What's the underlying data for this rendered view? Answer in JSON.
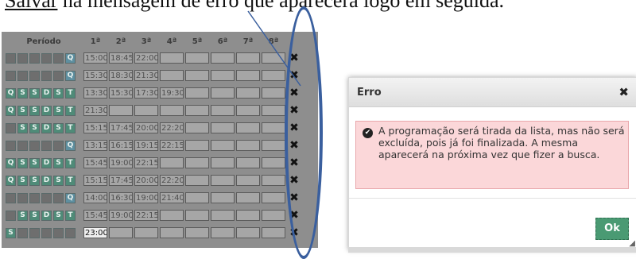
{
  "caption": {
    "underlined": "Salvar",
    "rest": " na mensagem de erro que aparecerá logo em seguida."
  },
  "table": {
    "headers": [
      "Período",
      "1ª",
      "2ª",
      "3ª",
      "4ª",
      "5ª",
      "6ª",
      "7ª",
      "8ª"
    ],
    "rows": [
      {
        "days": [
          "",
          "",
          "",
          "",
          "",
          "Q"
        ],
        "day_states": [
          "off",
          "off",
          "off",
          "off",
          "off",
          "sel"
        ],
        "slots": [
          "15:00",
          "18:45",
          "22:00",
          "",
          "",
          "",
          "",
          ""
        ]
      },
      {
        "days": [
          "",
          "",
          "",
          "",
          "",
          "Q"
        ],
        "day_states": [
          "off",
          "off",
          "off",
          "off",
          "off",
          "sel"
        ],
        "slots": [
          "15:30",
          "18:30",
          "21:30",
          "",
          "",
          "",
          "",
          ""
        ]
      },
      {
        "days": [
          "Q",
          "S",
          "S",
          "D",
          "S",
          "T"
        ],
        "day_states": [
          "on",
          "on",
          "on",
          "on",
          "on",
          "on"
        ],
        "slots": [
          "13:30",
          "15:30",
          "17:30",
          "19:30",
          "",
          "",
          "",
          ""
        ]
      },
      {
        "days": [
          "Q",
          "S",
          "S",
          "D",
          "S",
          "T"
        ],
        "day_states": [
          "on",
          "on",
          "on",
          "on",
          "on",
          "on"
        ],
        "slots": [
          "21:30",
          "",
          "",
          "",
          "",
          "",
          "",
          ""
        ]
      },
      {
        "days": [
          "",
          "S",
          "S",
          "D",
          "S",
          "T"
        ],
        "day_states": [
          "off",
          "on",
          "on",
          "on",
          "on",
          "on"
        ],
        "slots": [
          "15:15",
          "17:45",
          "20:00",
          "22:20",
          "",
          "",
          "",
          ""
        ]
      },
      {
        "days": [
          "",
          "",
          "",
          "",
          "",
          "Q"
        ],
        "day_states": [
          "off",
          "off",
          "off",
          "off",
          "off",
          "sel"
        ],
        "slots": [
          "13:15",
          "16:15",
          "19:15",
          "22:15",
          "",
          "",
          "",
          ""
        ]
      },
      {
        "days": [
          "Q",
          "S",
          "S",
          "D",
          "S",
          "T"
        ],
        "day_states": [
          "on",
          "on",
          "on",
          "on",
          "on",
          "on"
        ],
        "slots": [
          "15:45",
          "19:00",
          "22:15",
          "",
          "",
          "",
          "",
          ""
        ]
      },
      {
        "days": [
          "Q",
          "S",
          "S",
          "D",
          "S",
          "T"
        ],
        "day_states": [
          "on",
          "on",
          "on",
          "on",
          "on",
          "on"
        ],
        "slots": [
          "15:15",
          "17:45",
          "20:00",
          "22:20",
          "",
          "",
          "",
          ""
        ]
      },
      {
        "days": [
          "",
          "",
          "",
          "",
          "",
          "Q"
        ],
        "day_states": [
          "off",
          "off",
          "off",
          "off",
          "off",
          "sel"
        ],
        "slots": [
          "14:00",
          "16:30",
          "19:00",
          "21:40",
          "",
          "",
          "",
          ""
        ]
      },
      {
        "days": [
          "",
          "S",
          "S",
          "D",
          "S",
          "T"
        ],
        "day_states": [
          "off",
          "on",
          "on",
          "on",
          "on",
          "on"
        ],
        "slots": [
          "15:45",
          "19:00",
          "22:15",
          "",
          "",
          "",
          "",
          ""
        ]
      },
      {
        "days": [
          "S",
          "",
          "",
          "",
          "",
          ""
        ],
        "day_states": [
          "on",
          "off",
          "off",
          "off",
          "off",
          "off"
        ],
        "slots": [
          "23:00",
          "",
          "",
          "",
          "",
          "",
          "",
          ""
        ],
        "first_light": true
      }
    ],
    "delete_symbol": "✖"
  },
  "dialog": {
    "title": "Erro",
    "close_symbol": "✖",
    "message": "A programação será tirada da lista, mas não será excluída, pois já foi finalizada. A mesma aparecerá na próxima vez que fizer a busca.",
    "ok_label": "Ok"
  },
  "colors": {
    "highlight": "#3a5f9e",
    "ok_button": "#4a9a73",
    "error_bg": "#fbd7d9"
  }
}
